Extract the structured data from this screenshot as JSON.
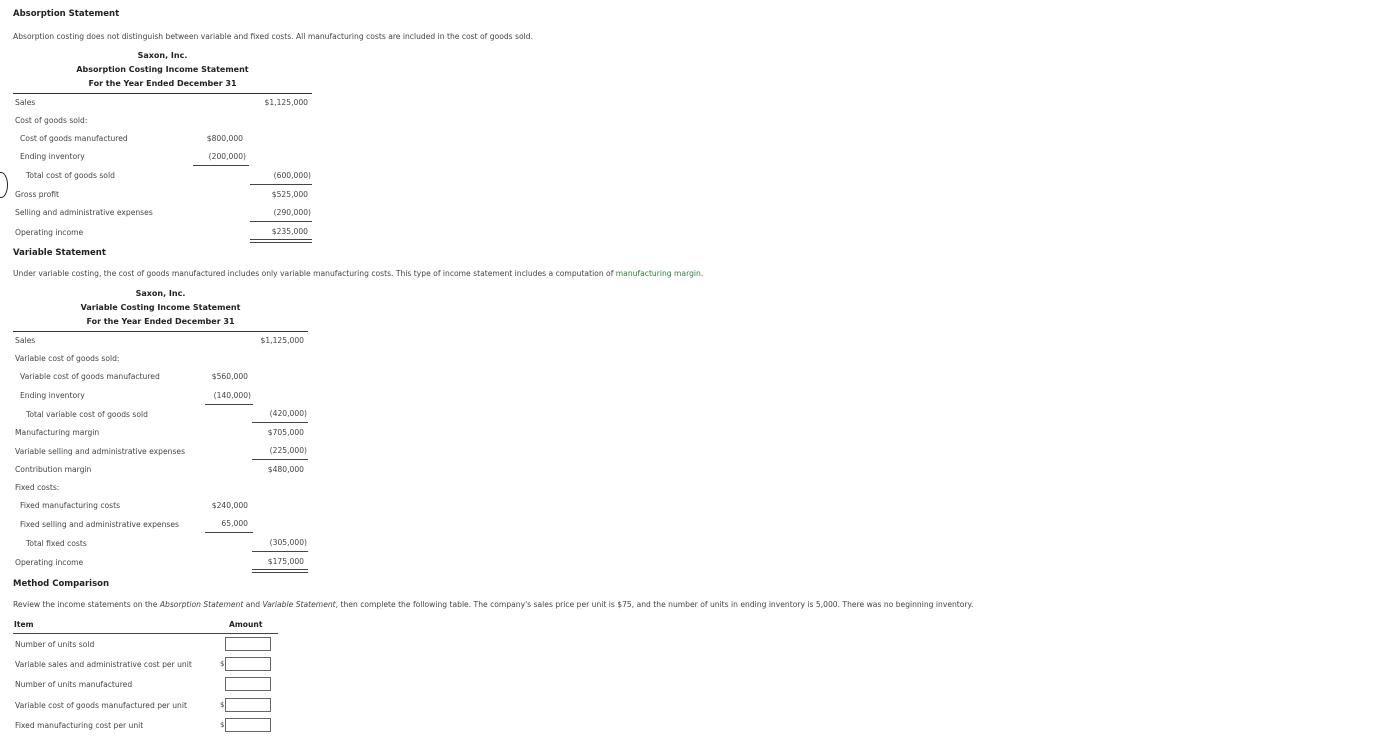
{
  "absorption": {
    "heading": "Absorption Statement",
    "intro": "Absorption costing does not distinguish between variable and fixed costs. All manufacturing costs are included in the cost of goods sold.",
    "company": "Saxon, Inc.",
    "title": "Absorption Costing Income Statement",
    "period": "For the Year Ended December 31",
    "rows": {
      "sales": {
        "label": "Sales",
        "amount": "$1,125,000"
      },
      "cogs_header": {
        "label": "Cost of goods sold:"
      },
      "cogm": {
        "label": "Cost of goods manufactured",
        "amount": "$800,000"
      },
      "ending_inventory": {
        "label": "Ending inventory",
        "amount": "(200,000)"
      },
      "total_cogs": {
        "label": "Total cost of goods sold",
        "amount": "(600,000)"
      },
      "gross_profit": {
        "label": "Gross profit",
        "amount": "$525,000"
      },
      "sga": {
        "label": "Selling and administrative expenses",
        "amount": "(290,000)"
      },
      "operating_income": {
        "label": "Operating income",
        "amount": "$235,000"
      }
    }
  },
  "variable": {
    "heading": "Variable Statement",
    "intro_text": "Under variable costing, the cost of goods manufactured includes only variable manufacturing costs. This type of income statement includes a computation of ",
    "intro_link": "manufacturing margin",
    "intro_end": ".",
    "company": "Saxon, Inc.",
    "title": "Variable Costing Income Statement",
    "period": "For the Year Ended December 31",
    "rows": {
      "sales": {
        "label": "Sales",
        "amount": "$1,125,000"
      },
      "vcogs_header": {
        "label": "Variable cost of goods sold:"
      },
      "vcogm": {
        "label": "Variable cost of goods manufactured",
        "amount": "$560,000"
      },
      "ending_inventory": {
        "label": "Ending inventory",
        "amount": "(140,000)"
      },
      "total_vcogs": {
        "label": "Total variable cost of goods sold",
        "amount": "(420,000)"
      },
      "mfg_margin": {
        "label": "Manufacturing margin",
        "amount": "$705,000"
      },
      "var_sga": {
        "label": "Variable selling and administrative expenses",
        "amount": "(225,000)"
      },
      "contribution_margin": {
        "label": "Contribution margin",
        "amount": "$480,000"
      },
      "fixed_header": {
        "label": "Fixed costs:"
      },
      "fixed_mfg": {
        "label": "Fixed manufacturing costs",
        "amount": "$240,000"
      },
      "fixed_sga": {
        "label": "Fixed selling and administrative expenses",
        "amount": "65,000"
      },
      "total_fixed": {
        "label": "Total fixed costs",
        "amount": "(305,000)"
      },
      "operating_income": {
        "label": "Operating income",
        "amount": "$175,000"
      }
    }
  },
  "comparison": {
    "heading": "Method Comparison",
    "intro_a": "Review the income statements on the ",
    "intro_em1": "Absorption Statement",
    "intro_b": " and ",
    "intro_em2": "Variable Statement",
    "intro_c": ", then complete the following table. The company's sales price per unit is $75, and the number of units in ending inventory is 5,000. There was no beginning inventory.",
    "col_item": "Item",
    "col_amount": "Amount",
    "currency_symbol": "$",
    "rows": [
      {
        "label": "Number of units sold",
        "value": ""
      },
      {
        "label": "Variable sales and administrative cost per unit",
        "value": ""
      },
      {
        "label": "Number of units manufactured",
        "value": ""
      },
      {
        "label": "Variable cost of goods manufactured per unit",
        "value": ""
      },
      {
        "label": "Fixed manufacturing cost per unit",
        "value": ""
      }
    ]
  }
}
